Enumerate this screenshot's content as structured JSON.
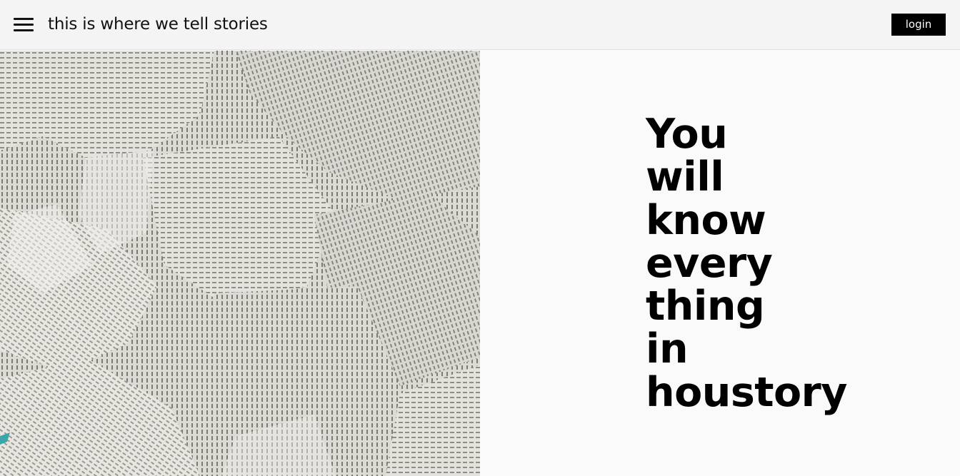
{
  "header": {
    "menu_icon": "hamburger-menu-icon",
    "title": "this is where we tell stories",
    "login_label": "login"
  },
  "hero": {
    "image": "torn-newspaper-collage",
    "tagline_lines": [
      "You",
      "will",
      "know",
      "every",
      "thing",
      "in",
      "houstory"
    ]
  }
}
